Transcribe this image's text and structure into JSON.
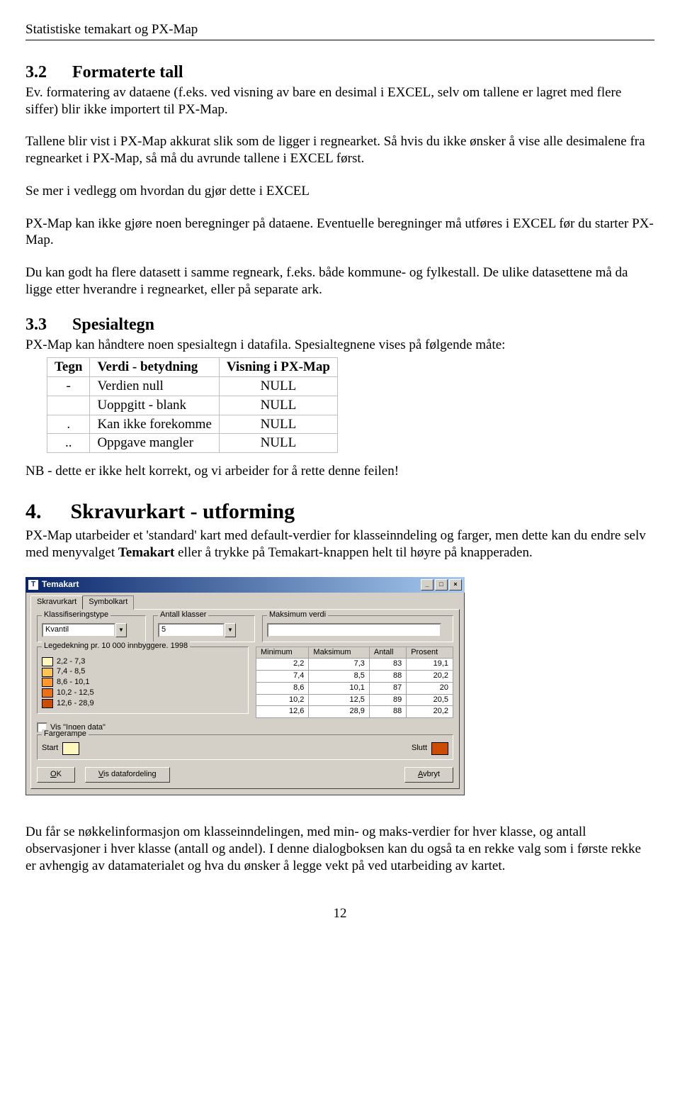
{
  "header": "Statistiske temakart og PX-Map",
  "sec32": {
    "num": "3.2",
    "title": "Formaterte tall",
    "p1": "Ev. formatering av dataene (f.eks. ved visning av bare en desimal i EXCEL, selv om tallene er lagret med flere siffer) blir ikke importert til PX-Map.",
    "p2": "Tallene blir vist i PX-Map akkurat slik som de ligger i regnearket. Så hvis du ikke ønsker å vise alle desimalene fra regnearket i PX-Map, så må du avrunde tallene i EXCEL først.",
    "p3": "Se mer i vedlegg om hvordan du gjør dette i EXCEL",
    "p4": "PX-Map kan ikke gjøre noen beregninger på dataene. Eventuelle beregninger må utføres i EXCEL før du starter PX-Map.",
    "p5": "Du kan godt ha flere datasett i samme regneark, f.eks. både kommune- og fylkestall. De ulike datasettene må da ligge etter hverandre i regnearket, eller på separate ark."
  },
  "sec33": {
    "num": "3.3",
    "title": "Spesialtegn",
    "intro": "PX-Map kan håndtere noen spesialtegn i datafila. Spesialtegnene vises på følgende måte:",
    "headers": [
      "Tegn",
      "Verdi - betydning",
      "Visning i PX-Map"
    ],
    "rows": [
      {
        "c0": "-",
        "c1": "Verdien null",
        "c2": "NULL"
      },
      {
        "c0": "",
        "c1": "Uoppgitt - blank",
        "c2": "NULL"
      },
      {
        "c0": ".",
        "c1": "Kan ikke forekomme",
        "c2": "NULL"
      },
      {
        "c0": "..",
        "c1": "Oppgave mangler",
        "c2": "NULL"
      }
    ],
    "note": "NB - dette er ikke helt korrekt, og vi arbeider for å rette denne feilen!"
  },
  "sec4": {
    "num": "4.",
    "title": "Skravurkart - utforming",
    "p1a": "PX-Map utarbeider et 'standard' kart med default-verdier for klasseinndeling og farger, men dette kan du endre selv med menyvalget ",
    "p1b": "Temakart",
    "p1c": " eller å trykke på Temakart-knappen helt til høyre på knapperaden.",
    "p2": "Du får se nøkkelinformasjon om klasseinndelingen, med min- og maks-verdier for hver klasse, og antall observasjoner i hver klasse (antall og andel). I denne dialogboksen kan du også ta en rekke valg som i første rekke er avhengig av datamaterialet og hva du ønsker å legge vekt på ved utarbeiding av kartet."
  },
  "dialog": {
    "title": "Temakart",
    "tabs": [
      "Skravurkart",
      "Symbolkart"
    ],
    "group_class": "Klassifiseringstype",
    "class_value": "Kvantil",
    "group_count": "Antall klasser",
    "count_value": "5",
    "group_max": "Maksimum verdi",
    "max_value": "",
    "legend_title": "Legedekning pr. 10 000 innbyggere. 1998",
    "legend_items": [
      {
        "color": "#fff7bc",
        "label": "2,2 - 7,3"
      },
      {
        "color": "#fec44f",
        "label": "7,4 - 8,5"
      },
      {
        "color": "#fe9929",
        "label": "8,6 - 10,1"
      },
      {
        "color": "#ec7014",
        "label": "10,2 - 12,5"
      },
      {
        "color": "#cc4c02",
        "label": "12,6 - 28,9"
      }
    ],
    "table_headers": [
      "Minimum",
      "Maksimum",
      "Antall",
      "Prosent"
    ],
    "table_rows": [
      [
        "2,2",
        "7,3",
        "83",
        "19,1"
      ],
      [
        "7,4",
        "8,5",
        "88",
        "20,2"
      ],
      [
        "8,6",
        "10,1",
        "87",
        "20"
      ],
      [
        "10,2",
        "12,5",
        "89",
        "20,5"
      ],
      [
        "12,6",
        "28,9",
        "88",
        "20,2"
      ]
    ],
    "chk_nodata": "Vis \"Ingen data\"",
    "group_ramp": "Fargerampe",
    "ramp_start": "Start",
    "ramp_start_color": "#fff7bc",
    "ramp_end": "Slutt",
    "ramp_end_color": "#cc4c02",
    "btn_ok": "OK",
    "btn_dist": "Vis datafordeling",
    "btn_cancel": "Avbryt"
  },
  "page_number": "12"
}
